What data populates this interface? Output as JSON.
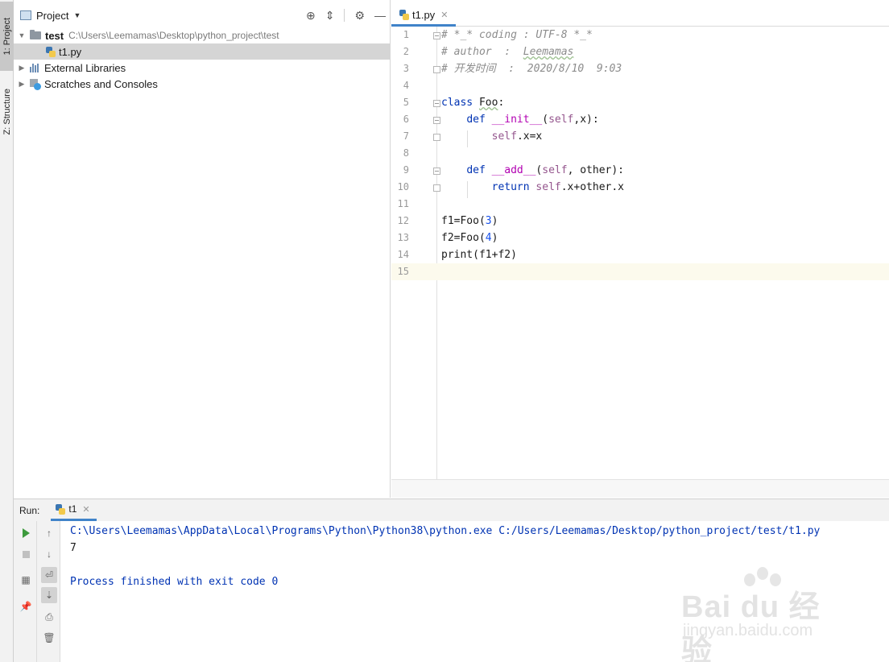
{
  "side_tabs": {
    "project": "1: Project",
    "structure": "Z: Structure"
  },
  "project": {
    "title": "Project",
    "tree": [
      {
        "name": "test",
        "path": "C:\\Users\\Leemamas\\Desktop\\python_project\\test"
      },
      {
        "name": "t1.py"
      },
      {
        "name": "External Libraries"
      },
      {
        "name": "Scratches and Consoles"
      }
    ]
  },
  "editor": {
    "tab": "t1.py",
    "line_numbers": [
      "1",
      "2",
      "3",
      "4",
      "5",
      "6",
      "7",
      "8",
      "9",
      "10",
      "11",
      "12",
      "13",
      "14",
      "15"
    ],
    "code": {
      "l1": "# *_* coding : UTF-8 *_*",
      "l2a": "# author  :  ",
      "l2b": "Leemamas",
      "l3": "# 开发时间  :  2020/8/10  9:03",
      "l5_kw": "class",
      "l5_name": "Foo",
      "l5_colon": ":",
      "l6_kw": "def",
      "l6_fn": "__init__",
      "l6_open": "(",
      "l6_self": "self",
      "l6_rest": ",x):",
      "l7_self": "self",
      "l7_rest": ".x=x",
      "l9_kw": "def",
      "l9_fn": "__add__",
      "l9_open": "(",
      "l9_self": "self",
      "l9_rest": ", other):",
      "l10_kw": "return",
      "l10_self": "self",
      "l10_rest": ".x+other.x",
      "l12_a": "f1=Foo(",
      "l12_n": "3",
      "l12_b": ")",
      "l13_a": "f2=Foo(",
      "l13_n": "4",
      "l13_b": ")",
      "l14": "print(f1+f2)"
    }
  },
  "run": {
    "label": "Run:",
    "tab": "t1",
    "console": [
      "C:\\Users\\Leemamas\\AppData\\Local\\Programs\\Python\\Python38\\python.exe C:/Users/Leemamas/Desktop/python_project/test/t1.py",
      "7",
      "",
      "Process finished with exit code 0"
    ]
  },
  "watermark": {
    "logo": "Bai du 经验",
    "url": "jingyan.baidu.com"
  },
  "colors": {
    "accent": "#4083c9",
    "keyword": "#0033b3",
    "magic": "#b200b2",
    "self": "#94558d",
    "number": "#1750eb",
    "comment": "#8c8c8c",
    "current_line": "#fcfaed"
  }
}
